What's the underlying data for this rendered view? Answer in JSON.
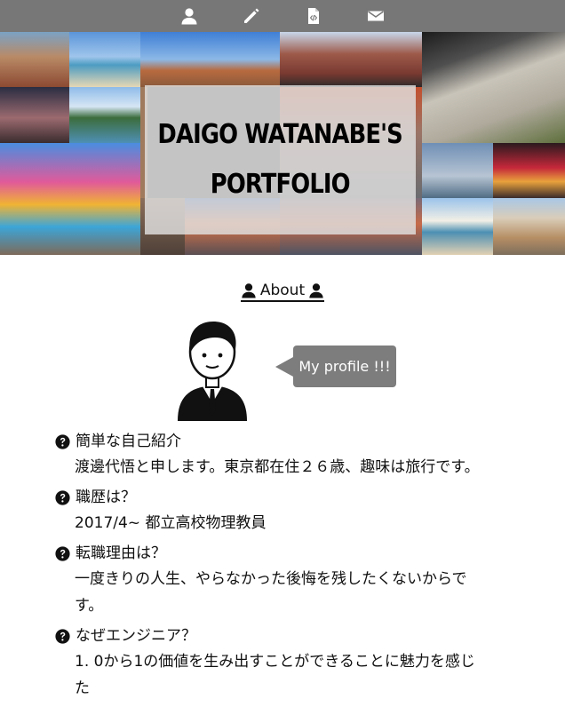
{
  "nav": {
    "items": [
      {
        "icon": "user-icon"
      },
      {
        "icon": "pencil-icon"
      },
      {
        "icon": "code-file-icon"
      },
      {
        "icon": "envelope-icon"
      }
    ]
  },
  "hero": {
    "title_line1": "DAIGO WATANABE'S",
    "title_line2": "PORTFOLIO"
  },
  "about": {
    "label": "About"
  },
  "profile": {
    "bubble": "My profile !!!"
  },
  "faq": [
    {
      "question": "簡単な自己紹介",
      "answer": "渡邊代悟と申します。東京都在住２６歳、趣味は旅行です。"
    },
    {
      "question": "職歴は？",
      "answer": "2017/4~ 都立高校物理教員"
    },
    {
      "question": "転職理由は？",
      "answer": "一度きりの人生、やらなかった後悔を残したくないからです。"
    },
    {
      "question": "なぜエンジニア？",
      "answer": "1. 0から1の価値を生み出すことができることに魅力を感じた"
    }
  ]
}
